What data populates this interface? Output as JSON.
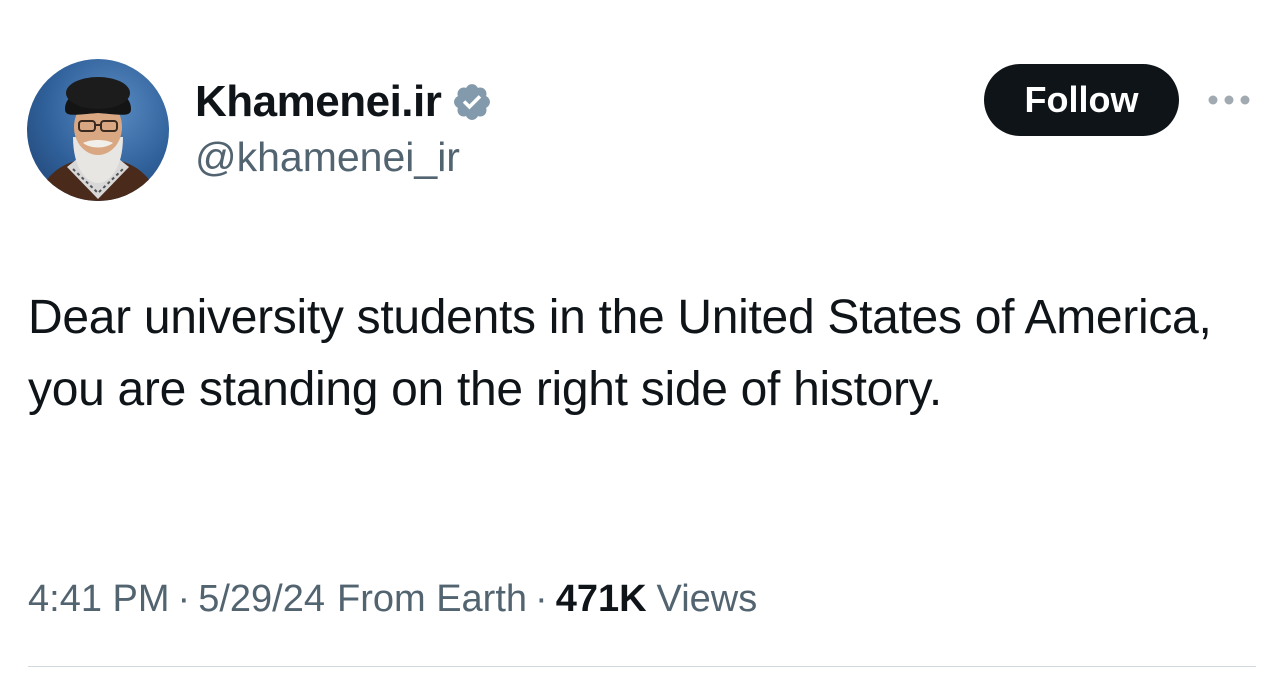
{
  "author": {
    "display_name": "Khamenei.ir",
    "handle": "@khamenei_ir",
    "verified": true,
    "avatar_icon": "profile-photo"
  },
  "actions": {
    "follow_label": "Follow",
    "more_icon": "more-horizontal-icon"
  },
  "tweet": {
    "text": "Dear university students in the United States of America, you are standing on the right side of history."
  },
  "meta": {
    "time": "4:41 PM",
    "separator": "·",
    "date": "5/29/24",
    "source": "From Earth",
    "views_count": "471K",
    "views_label": "Views"
  },
  "colors": {
    "text_primary": "#0f1419",
    "text_secondary": "#536471",
    "verified_badge": "#829aab",
    "follow_bg": "#0f1419",
    "divider": "#cfd9de"
  }
}
